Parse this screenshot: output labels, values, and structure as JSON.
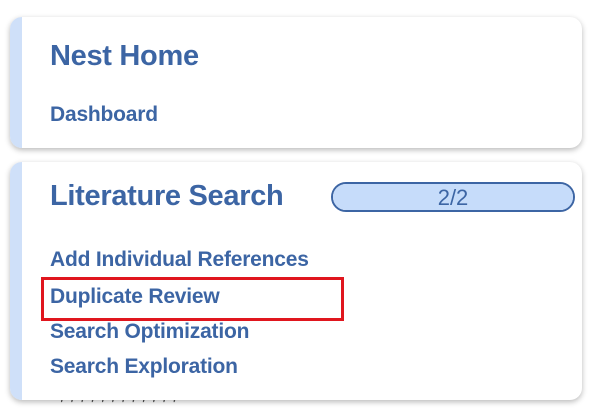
{
  "nest_home": {
    "title": "Nest Home",
    "links": [
      "Dashboard"
    ]
  },
  "literature_search": {
    "title": "Literature Search",
    "progress": {
      "text": "2/2",
      "fraction": 1.0
    },
    "links": [
      "Add Individual References",
      "Duplicate Review",
      "Search Optimization",
      "Search Exploration"
    ],
    "highlighted_link": "Duplicate Review"
  },
  "colors": {
    "link_blue": "#3c65a4",
    "accent_blue": "#cfe0f9",
    "progress_fill": "#c6dcfa",
    "highlight_red": "#e0161e"
  }
}
